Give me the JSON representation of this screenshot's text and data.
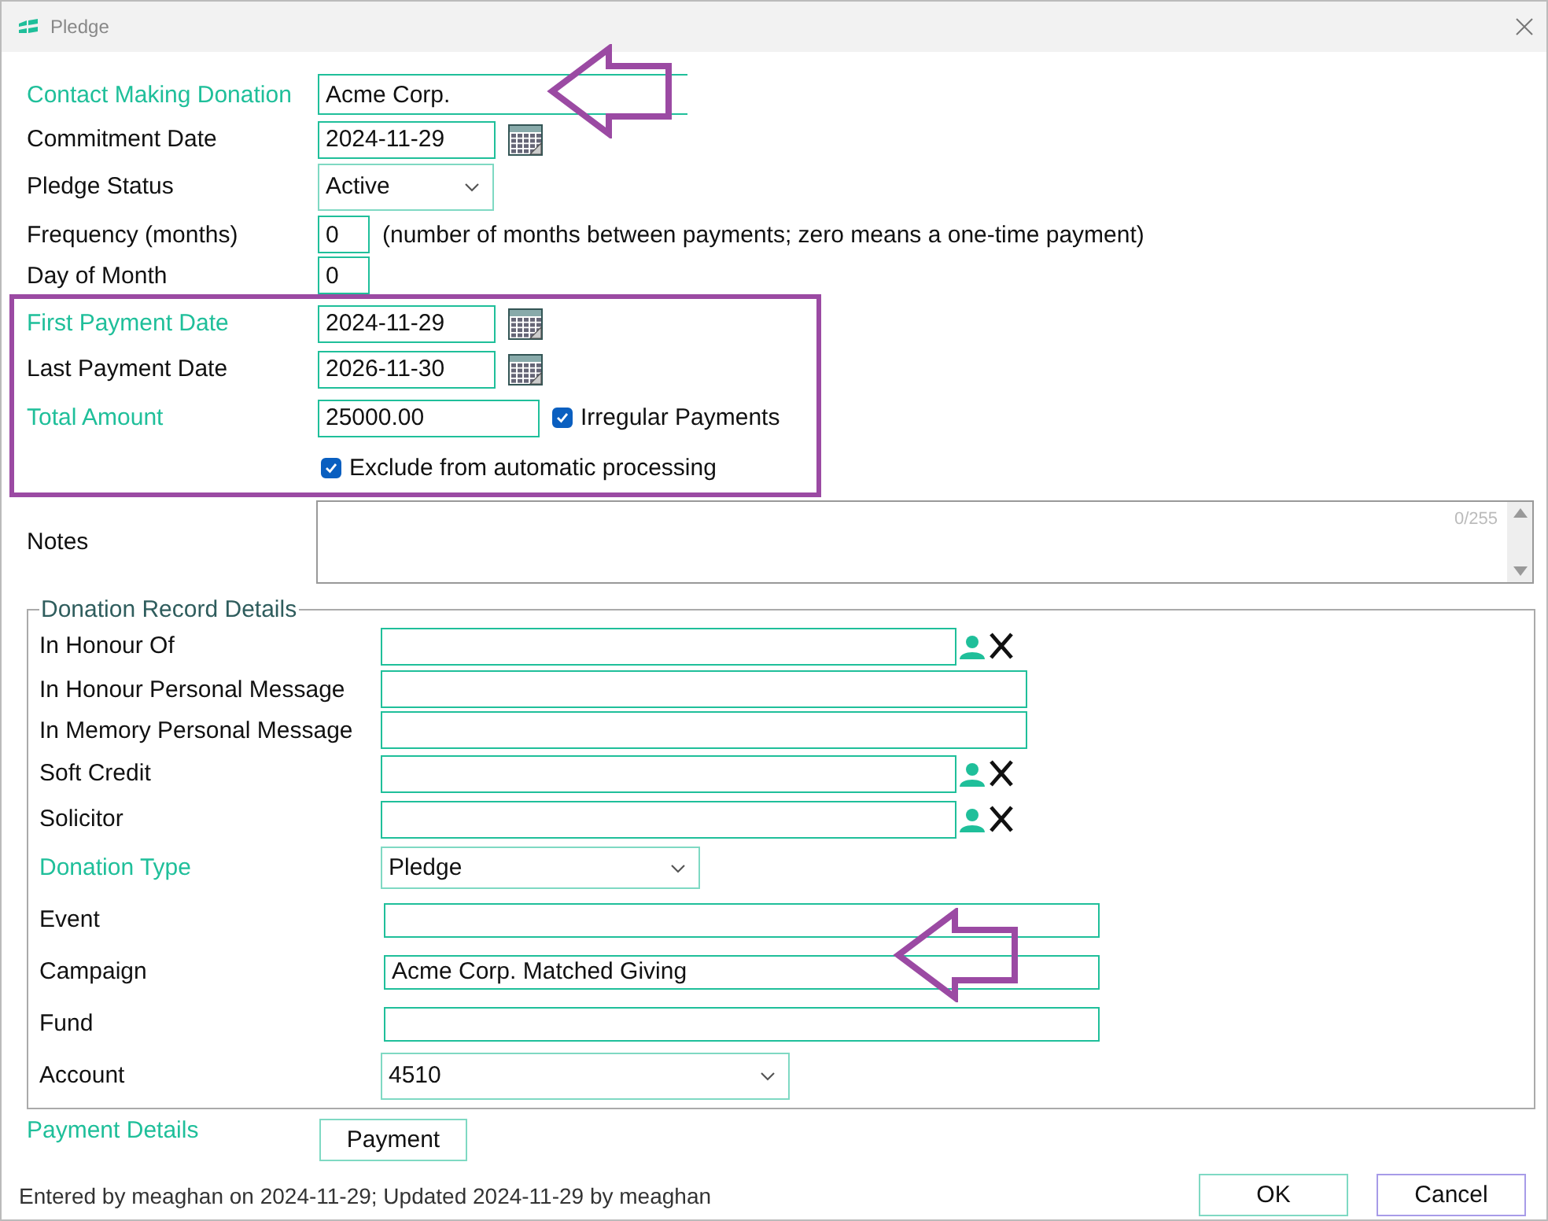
{
  "window": {
    "title": "Pledge"
  },
  "fields": [
    {
      "label": "Contact Making Donation",
      "required": true,
      "kind": "text",
      "value": "Acme Corp."
    },
    {
      "label": "Commitment Date",
      "required": false,
      "kind": "date",
      "value": "2024-11-29"
    },
    {
      "label": "Pledge Status",
      "required": false,
      "kind": "select",
      "value": "Active"
    },
    {
      "label": "Frequency (months)",
      "required": false,
      "kind": "number",
      "value": "0",
      "hint": "(number of months between payments; zero means a one-time payment)"
    },
    {
      "label": "Day of Month",
      "required": false,
      "kind": "number",
      "value": "0"
    }
  ],
  "payment_fields": [
    {
      "label": "First Payment Date",
      "required": true,
      "kind": "date",
      "value": "2024-11-29"
    },
    {
      "label": "Last Payment Date",
      "required": false,
      "kind": "date",
      "value": "2026-11-30"
    },
    {
      "label": "Total Amount",
      "required": true,
      "kind": "amount",
      "value": "25000.00",
      "checkbox": {
        "label": "Irregular Payments",
        "checked": true
      }
    }
  ],
  "exclude_checkbox": {
    "label": "Exclude from automatic processing",
    "checked": true
  },
  "notes": {
    "label": "Notes",
    "counter": "0/255"
  },
  "donation_record": {
    "legend": "Donation Record Details",
    "rows": [
      {
        "label": "In Honour Of",
        "required": false,
        "kind": "lookup"
      },
      {
        "label": "In Honour Personal Message",
        "required": false,
        "kind": "message"
      },
      {
        "label": "In Memory Personal Message",
        "required": false,
        "kind": "message"
      },
      {
        "label": "Soft Credit",
        "required": false,
        "kind": "lookup"
      },
      {
        "label": "Solicitor",
        "required": false,
        "kind": "lookup"
      },
      {
        "label": "Donation Type",
        "required": true,
        "kind": "select",
        "value": "Pledge"
      },
      {
        "label": "Event",
        "required": false,
        "kind": "entry"
      },
      {
        "label": "Campaign",
        "required": false,
        "kind": "entry",
        "value": "Acme Corp. Matched Giving"
      },
      {
        "label": "Fund",
        "required": false,
        "kind": "entry"
      },
      {
        "label": "Account",
        "required": false,
        "kind": "account",
        "value": "4510"
      }
    ]
  },
  "payment": {
    "label": "Payment Details",
    "button": "Payment"
  },
  "footer": {
    "audit": "Entered by meaghan on 2024-11-29; Updated 2024-11-29 by meaghan",
    "buttons": [
      {
        "label": "OK",
        "focused": false
      },
      {
        "label": "Cancel",
        "focused": true
      }
    ]
  }
}
